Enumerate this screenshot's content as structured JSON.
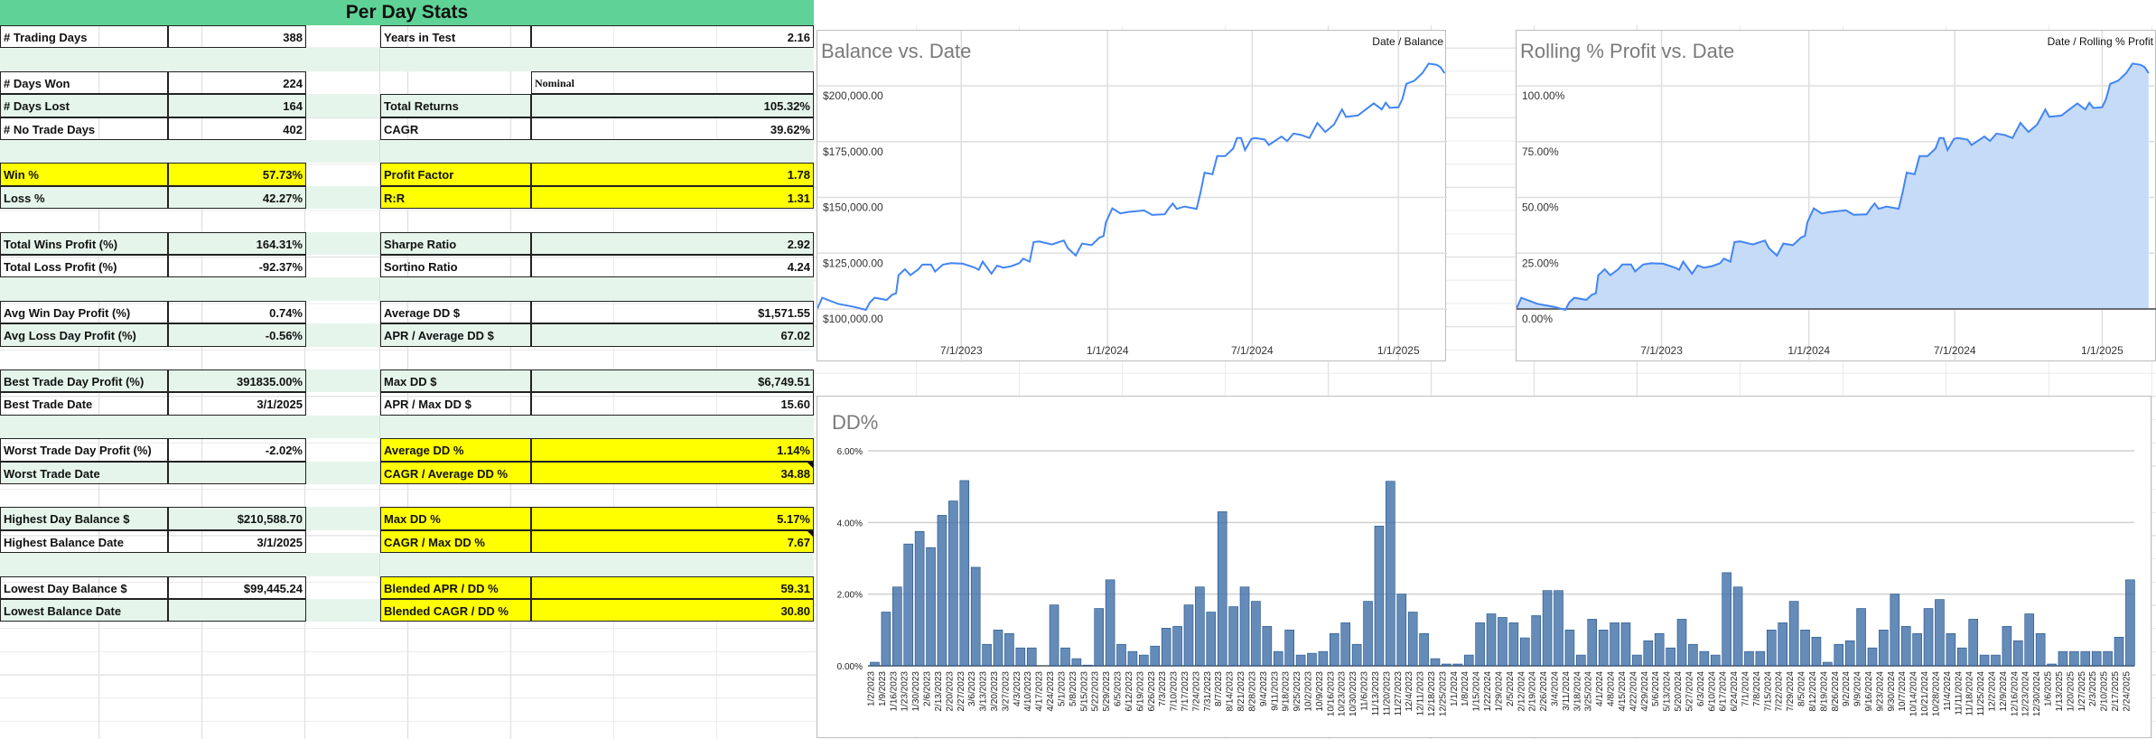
{
  "sheet": {
    "title": "Per Day Stats",
    "header_color": "#5fd397",
    "highlight_color": "#ffff00",
    "band_color": "#e5f5ec",
    "rows": [
      {
        "left": {
          "label": "# Trading Days",
          "value": "388"
        },
        "right": {
          "label": "Years in Test",
          "value": "2.16"
        }
      },
      null,
      {
        "left": {
          "label": "# Days Won",
          "value": "224"
        },
        "right": {
          "label": "",
          "value": "Nominal",
          "serif": true
        }
      },
      {
        "left": {
          "label": "# Days Lost",
          "value": "164"
        },
        "right": {
          "label": "Total Returns",
          "value": "105.32%"
        }
      },
      {
        "left": {
          "label": "# No Trade Days",
          "value": "402"
        },
        "right": {
          "label": "CAGR",
          "value": "39.62%"
        }
      },
      null,
      {
        "left": {
          "label": "Win %",
          "value": "57.73%",
          "highlight": true
        },
        "right": {
          "label": "Profit Factor",
          "value": "1.78",
          "highlight": true
        }
      },
      {
        "left": {
          "label": "Loss %",
          "value": "42.27%"
        },
        "right": {
          "label": "R:R",
          "value": "1.31",
          "highlight": true
        }
      },
      null,
      {
        "left": {
          "label": "Total Wins Profit (%)",
          "value": "164.31%"
        },
        "right": {
          "label": "Sharpe Ratio",
          "value": "2.92"
        }
      },
      {
        "left": {
          "label": "Total Loss Profit (%)",
          "value": "-92.37%"
        },
        "right": {
          "label": "Sortino Ratio",
          "value": "4.24"
        }
      },
      null,
      {
        "left": {
          "label": "Avg Win Day Profit (%)",
          "value": "0.74%"
        },
        "right": {
          "label": "Average DD $",
          "value": "$1,571.55"
        }
      },
      {
        "left": {
          "label": "Avg Loss Day Profit (%)",
          "value": "-0.56%"
        },
        "right": {
          "label": "APR / Average DD $",
          "value": "67.02"
        }
      },
      null,
      {
        "left": {
          "label": "Best Trade Day Profit (%)",
          "value": "391835.00%"
        },
        "right": {
          "label": "Max DD $",
          "value": "$6,749.51"
        }
      },
      {
        "left": {
          "label": "Best Trade Date",
          "value": "3/1/2025"
        },
        "right": {
          "label": "APR / Max DD $",
          "value": "15.60"
        }
      },
      null,
      {
        "left": {
          "label": "Worst Trade Day Profit (%)",
          "value": "-2.02%"
        },
        "right": {
          "label": "Average DD %",
          "value": "1.14%",
          "highlight": true
        }
      },
      {
        "left": {
          "label": "Worst Trade Date",
          "value": ""
        },
        "right": {
          "label": "CAGR / Average DD %",
          "value": "34.88",
          "highlight": true,
          "comment": true
        }
      },
      null,
      {
        "left": {
          "label": "Highest Day Balance $",
          "value": "$210,588.70"
        },
        "right": {
          "label": "Max DD %",
          "value": "5.17%",
          "highlight": true
        }
      },
      {
        "left": {
          "label": "Highest Balance Date",
          "value": "3/1/2025"
        },
        "right": {
          "label": "CAGR / Max DD %",
          "value": "7.67",
          "highlight": true,
          "comment": true
        }
      },
      null,
      {
        "left": {
          "label": "Lowest Day Balance $",
          "value": "$99,445.24"
        },
        "right": {
          "label": "Blended APR / DD %",
          "value": "59.31",
          "highlight": true
        }
      },
      {
        "left": {
          "label": "Lowest Balance Date",
          "value": ""
        },
        "right": {
          "label": "Blended CAGR / DD %",
          "value": "30.80",
          "highlight": true
        }
      }
    ]
  },
  "chart_data": [
    {
      "type": "line",
      "title": "Balance vs. Date",
      "legend": "Date / Balance",
      "legend_position": "top-right",
      "line_color": "#4285f4",
      "x_unit": "days since 1/1/2023",
      "xlim": [
        0,
        790
      ],
      "x_ticks": [
        {
          "day": 181,
          "label": "7/1/2023"
        },
        {
          "day": 365,
          "label": "1/1/2024"
        },
        {
          "day": 547,
          "label": "7/1/2024"
        },
        {
          "day": 731,
          "label": "1/1/2025"
        }
      ],
      "y_ticks": [
        {
          "value": 100000,
          "label": "$100,000.00"
        },
        {
          "value": 125000,
          "label": "$125,000.00"
        },
        {
          "value": 150000,
          "label": "$150,000.00"
        },
        {
          "value": 175000,
          "label": "$175,000.00"
        },
        {
          "value": 200000,
          "label": "$200,000.00"
        }
      ],
      "x": [
        0,
        6,
        16,
        26,
        46,
        61,
        66,
        72,
        87,
        94,
        99,
        102,
        110,
        117,
        127,
        132,
        143,
        148,
        158,
        168,
        183,
        198,
        203,
        208,
        219,
        226,
        234,
        244,
        254,
        259,
        267,
        272,
        279,
        295,
        310,
        315,
        325,
        333,
        345,
        355,
        360,
        363,
        371,
        381,
        391,
        411,
        421,
        437,
        442,
        447,
        452,
        462,
        477,
        482,
        487,
        497,
        503,
        513,
        523,
        528,
        533,
        538,
        546,
        551,
        563,
        568,
        584,
        591,
        599,
        609,
        619,
        629,
        639,
        650,
        660,
        665,
        680,
        690,
        700,
        710,
        715,
        720,
        731,
        736,
        741,
        751,
        761,
        769,
        779,
        784,
        789
      ],
      "y": [
        100270,
        105000,
        103650,
        102300,
        100950,
        99600,
        102970,
        105000,
        104050,
        106350,
        107020,
        115130,
        117830,
        115130,
        117830,
        119860,
        119860,
        116750,
        119860,
        120540,
        120270,
        118510,
        117560,
        121210,
        115810,
        119450,
        118510,
        119180,
        120540,
        122560,
        121210,
        129990,
        130260,
        128910,
        130670,
        127290,
        123910,
        129320,
        128640,
        132020,
        132690,
        138770,
        145120,
        142830,
        143500,
        144180,
        142150,
        142420,
        145120,
        147290,
        144850,
        145930,
        144850,
        152280,
        161070,
        160390,
        168500,
        168500,
        171870,
        176600,
        176600,
        171200,
        176200,
        176600,
        175930,
        173500,
        177280,
        175250,
        178630,
        177950,
        176600,
        183360,
        179300,
        182680,
        189440,
        186060,
        186730,
        189440,
        192140,
        189440,
        192410,
        190110,
        190380,
        194160,
        200920,
        202270,
        205650,
        209970,
        209430,
        208350,
        205650
      ]
    },
    {
      "type": "area",
      "title": "Rolling % Profit vs. Date",
      "legend": "Date / Rolling % Profit",
      "legend_position": "top-right",
      "line_color": "#4285f4",
      "fill_color": "#c6dbf7",
      "x_unit": "days since 1/1/2023",
      "xlim": [
        0,
        790
      ],
      "x_ticks": [
        {
          "day": 181,
          "label": "7/1/2023"
        },
        {
          "day": 365,
          "label": "1/1/2024"
        },
        {
          "day": 547,
          "label": "7/1/2024"
        },
        {
          "day": 731,
          "label": "1/1/2025"
        }
      ],
      "y_ticks": [
        {
          "value": 0,
          "label": "0.00%"
        },
        {
          "value": 25,
          "label": "25.00%"
        },
        {
          "value": 50,
          "label": "50.00%"
        },
        {
          "value": 75,
          "label": "75.00%"
        },
        {
          "value": 100,
          "label": "100.00%"
        }
      ],
      "x": [
        0,
        6,
        16,
        26,
        46,
        61,
        66,
        72,
        87,
        94,
        99,
        102,
        110,
        117,
        127,
        132,
        143,
        148,
        158,
        168,
        183,
        198,
        203,
        208,
        219,
        226,
        234,
        244,
        254,
        259,
        267,
        272,
        279,
        295,
        310,
        315,
        325,
        333,
        345,
        355,
        360,
        363,
        371,
        381,
        391,
        411,
        421,
        437,
        442,
        447,
        452,
        462,
        477,
        482,
        487,
        497,
        503,
        513,
        523,
        528,
        533,
        538,
        546,
        551,
        563,
        568,
        584,
        591,
        599,
        609,
        619,
        629,
        639,
        650,
        660,
        665,
        680,
        690,
        700,
        710,
        715,
        720,
        731,
        736,
        741,
        751,
        761,
        769,
        779,
        784,
        789
      ],
      "y": [
        0.3,
        5.0,
        3.7,
        2.3,
        1.0,
        -0.4,
        3.0,
        5.0,
        4.1,
        6.4,
        7.0,
        15.1,
        17.8,
        15.1,
        17.8,
        19.9,
        19.9,
        16.8,
        19.9,
        20.5,
        20.3,
        18.5,
        17.6,
        21.2,
        15.8,
        19.5,
        18.5,
        19.2,
        20.5,
        22.6,
        21.2,
        30.0,
        30.3,
        28.9,
        30.7,
        27.3,
        23.9,
        29.3,
        28.6,
        32.0,
        32.7,
        38.8,
        45.1,
        42.8,
        43.5,
        44.2,
        42.2,
        42.4,
        45.1,
        47.3,
        44.9,
        45.9,
        44.9,
        52.3,
        61.1,
        60.4,
        68.5,
        68.5,
        71.9,
        76.6,
        76.6,
        71.2,
        76.2,
        76.6,
        75.9,
        73.5,
        77.3,
        75.3,
        78.6,
        78.0,
        76.6,
        83.4,
        79.3,
        82.7,
        89.4,
        86.1,
        86.7,
        89.4,
        92.1,
        89.4,
        92.4,
        90.1,
        90.4,
        94.2,
        100.9,
        102.3,
        105.7,
        110.0,
        109.4,
        108.4,
        105.7
      ]
    },
    {
      "type": "bar",
      "title": "DD%",
      "bar_color": "#3f6fa6",
      "ylim": [
        0,
        6
      ],
      "y_ticks": [
        {
          "value": 0,
          "label": "0.00%"
        },
        {
          "value": 2,
          "label": "2.00%"
        },
        {
          "value": 4,
          "label": "4.00%"
        },
        {
          "value": 6,
          "label": "6.00%"
        }
      ],
      "categories": [
        "1/2/2023",
        "1/9/2023",
        "1/16/2023",
        "1/23/2023",
        "1/30/2023",
        "2/6/2023",
        "2/13/2023",
        "2/20/2023",
        "2/27/2023",
        "3/6/2023",
        "3/13/2023",
        "3/20/2023",
        "3/27/2023",
        "4/3/2023",
        "4/10/2023",
        "4/17/2023",
        "4/24/2023",
        "5/1/2023",
        "5/8/2023",
        "5/15/2023",
        "5/22/2023",
        "5/29/2023",
        "6/5/2023",
        "6/12/2023",
        "6/19/2023",
        "6/26/2023",
        "7/3/2023",
        "7/10/2023",
        "7/17/2023",
        "7/24/2023",
        "7/31/2023",
        "8/7/2023",
        "8/14/2023",
        "8/21/2023",
        "8/28/2023",
        "9/4/2023",
        "9/11/2023",
        "9/18/2023",
        "9/25/2023",
        "10/2/2023",
        "10/9/2023",
        "10/16/2023",
        "10/23/2023",
        "10/30/2023",
        "11/6/2023",
        "11/13/2023",
        "11/20/2023",
        "11/27/2023",
        "12/4/2023",
        "12/11/2023",
        "12/18/2023",
        "12/25/2023",
        "1/1/2024",
        "1/8/2024",
        "1/15/2024",
        "1/22/2024",
        "1/29/2024",
        "2/5/2024",
        "2/12/2024",
        "2/19/2024",
        "2/26/2024",
        "3/4/2024",
        "3/11/2024",
        "3/18/2024",
        "3/25/2024",
        "4/1/2024",
        "4/8/2024",
        "4/15/2024",
        "4/22/2024",
        "4/29/2024",
        "5/6/2024",
        "5/13/2024",
        "5/20/2024",
        "5/27/2024",
        "6/3/2024",
        "6/10/2024",
        "6/17/2024",
        "6/24/2024",
        "7/1/2024",
        "7/8/2024",
        "7/15/2024",
        "7/22/2024",
        "7/29/2024",
        "8/5/2024",
        "8/12/2024",
        "8/19/2024",
        "8/26/2024",
        "9/2/2024",
        "9/9/2024",
        "9/16/2024",
        "9/23/2024",
        "9/30/2024",
        "10/7/2024",
        "10/14/2024",
        "10/21/2024",
        "10/28/2024",
        "11/4/2024",
        "11/11/2024",
        "11/18/2024",
        "11/25/2024",
        "12/2/2024",
        "12/9/2024",
        "12/16/2024",
        "12/23/2024",
        "12/30/2024",
        "1/6/2025",
        "1/13/2025",
        "1/20/2025",
        "1/27/2025",
        "2/3/2025",
        "2/10/2025",
        "2/17/2025",
        "2/24/2025"
      ],
      "values": [
        0.1,
        1.5,
        2.2,
        3.4,
        3.75,
        3.3,
        4.2,
        4.6,
        5.17,
        2.75,
        0.6,
        1.0,
        0.9,
        0.5,
        0.5,
        0,
        1.7,
        0.5,
        0.2,
        0.02,
        1.6,
        2.4,
        0.6,
        0.4,
        0.3,
        0.55,
        1.05,
        1.1,
        1.7,
        2.2,
        1.5,
        4.3,
        1.65,
        2.2,
        1.8,
        1.1,
        0.4,
        1.0,
        0.3,
        0.35,
        0.4,
        0.9,
        1.2,
        0.6,
        1.8,
        3.9,
        5.15,
        2.0,
        1.5,
        0.9,
        0.2,
        0.05,
        0.05,
        0.3,
        1.2,
        1.45,
        1.35,
        1.2,
        0.78,
        1.4,
        2.1,
        2.1,
        1.0,
        0.3,
        1.3,
        1.0,
        1.2,
        1.2,
        0.3,
        0.7,
        0.9,
        0.5,
        1.3,
        0.6,
        0.4,
        0.3,
        2.6,
        2.2,
        0.4,
        0.4,
        1.0,
        1.2,
        1.8,
        1.0,
        0.8,
        0.1,
        0.6,
        0.7,
        1.6,
        0.5,
        1.0,
        2.0,
        1.1,
        0.9,
        1.6,
        1.85,
        0.9,
        0.5,
        1.3,
        0.3,
        0.3,
        1.1,
        0.7,
        1.45,
        0.9,
        0.05,
        0.4,
        0.4,
        0.4,
        0.4,
        0.4,
        0.8,
        2.4
      ]
    }
  ]
}
